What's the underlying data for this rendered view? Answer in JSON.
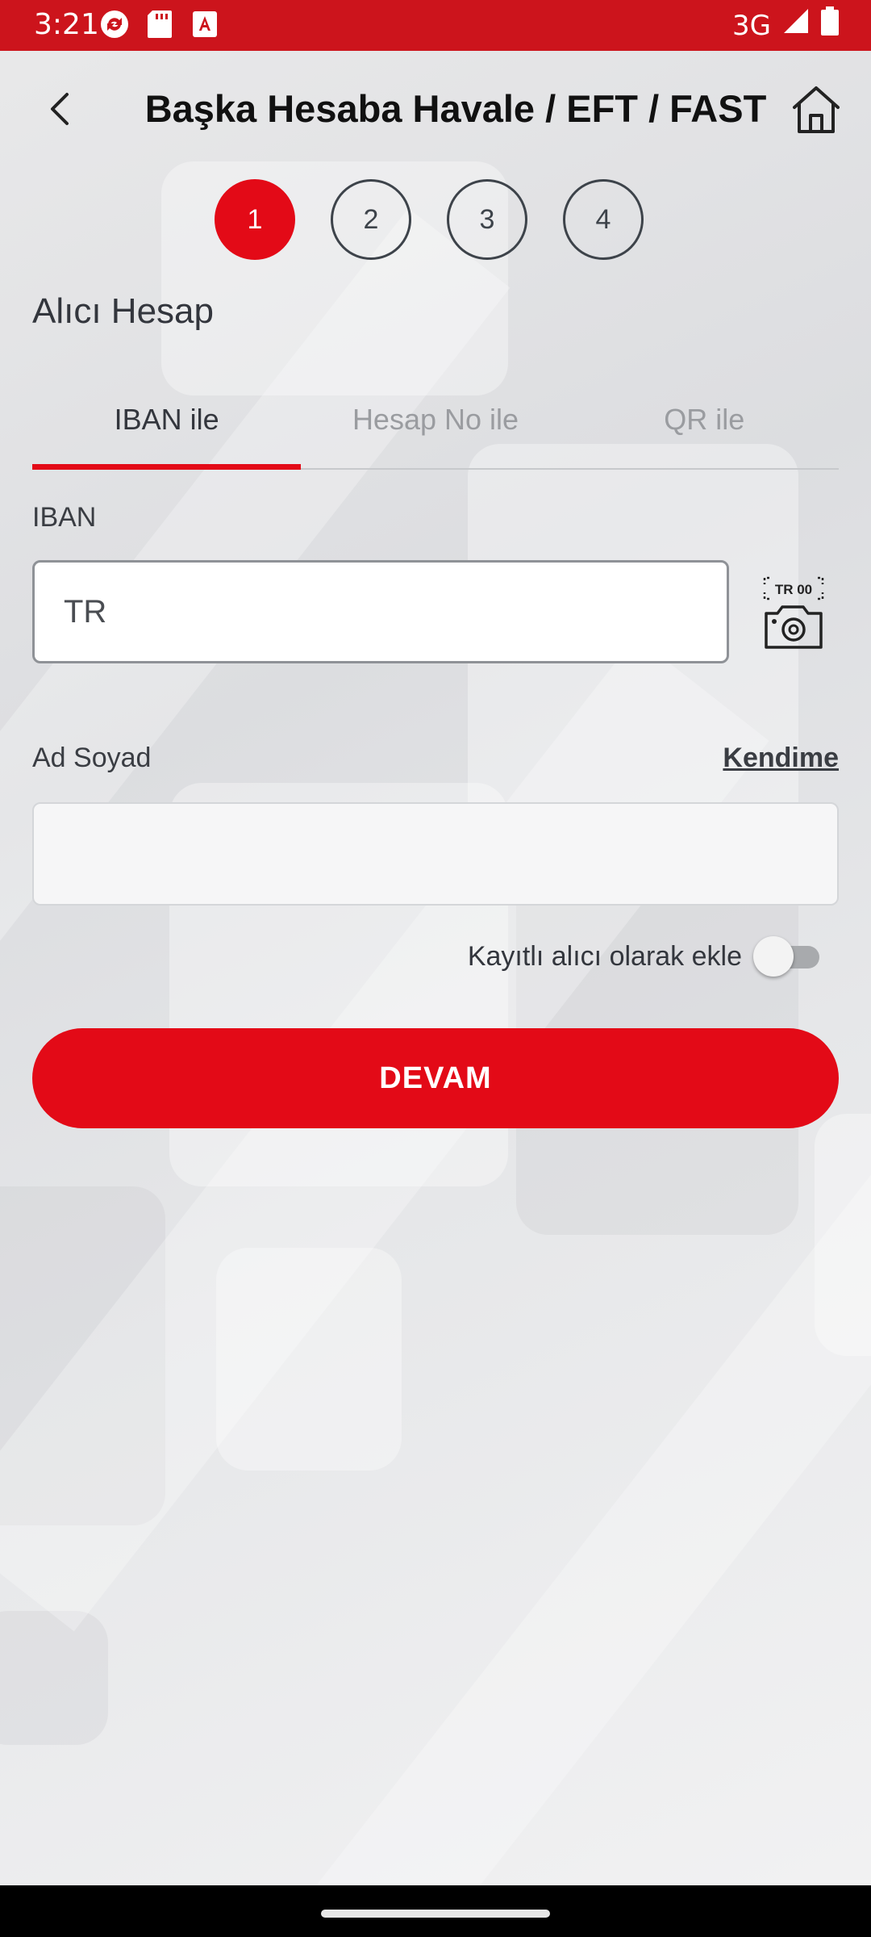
{
  "status_bar": {
    "time": "3:21",
    "network": "3G"
  },
  "header": {
    "title": "Başka Hesaba Havale / EFT / FAST"
  },
  "stepper": {
    "steps": [
      "1",
      "2",
      "3",
      "4"
    ],
    "active_step": 1
  },
  "section": {
    "title": "Alıcı Hesap"
  },
  "tabs": [
    {
      "label": "IBAN ile",
      "active": true
    },
    {
      "label": "Hesap No ile",
      "active": false
    },
    {
      "label": "QR ile",
      "active": false
    }
  ],
  "form": {
    "iban_label": "IBAN",
    "iban_value": "TR",
    "scan_icon_text": "TR 00",
    "name_label": "Ad Soyad",
    "name_value": "",
    "self_link": "Kendime",
    "save_recipient_label": "Kayıtlı alıcı olarak ekle",
    "save_recipient_on": false
  },
  "actions": {
    "continue_label": "DEVAM"
  },
  "colors": {
    "brand_red": "#e30a17",
    "status_bar": "#cc141c"
  }
}
